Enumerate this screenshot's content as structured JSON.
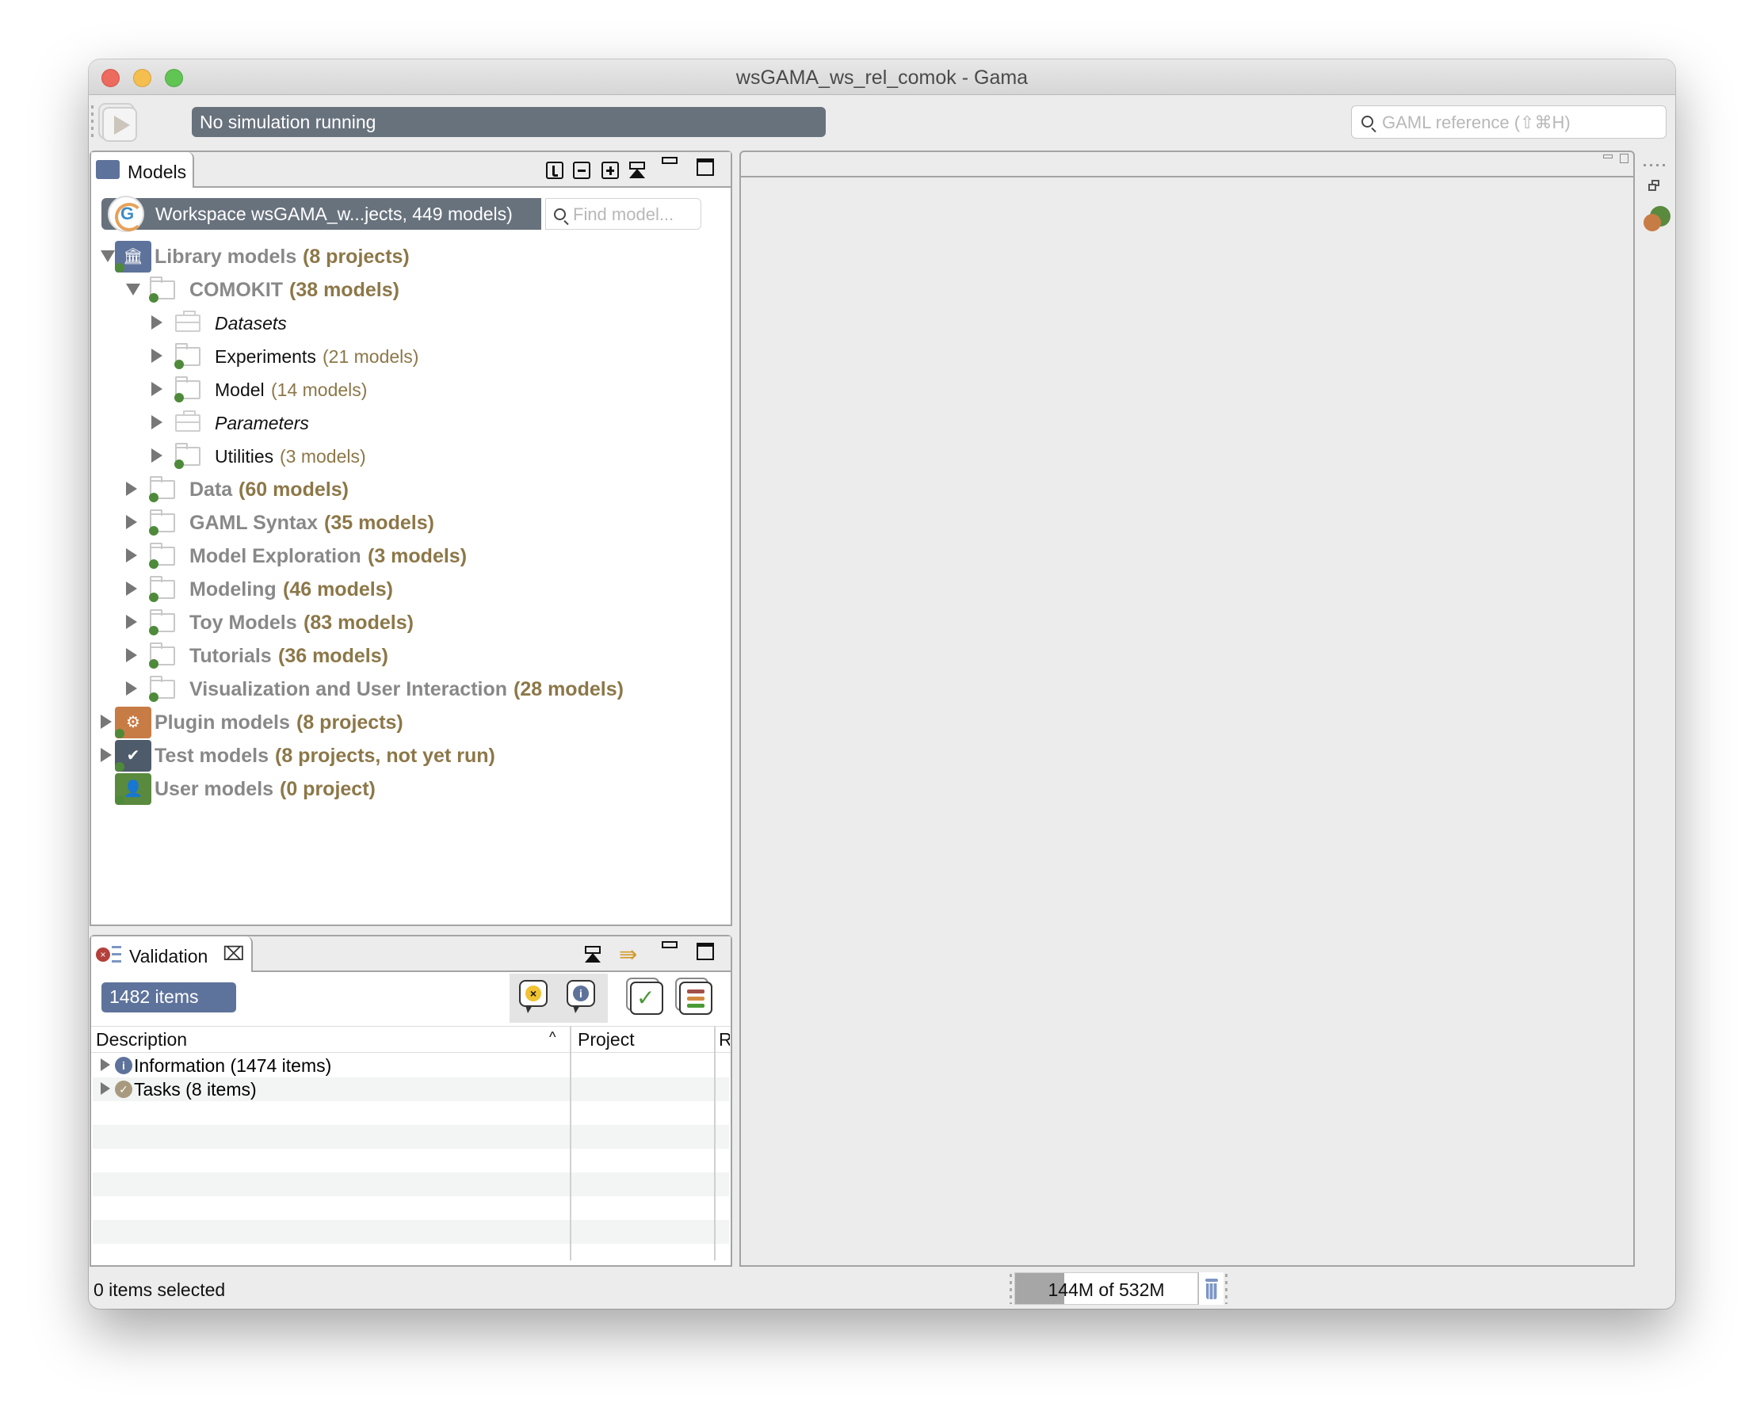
{
  "window": {
    "title": "wsGAMA_ws_rel_comok - Gama"
  },
  "toolbar": {
    "simulation_status": "No simulation running",
    "gaml_search_placeholder": "GAML reference (⇧⌘H)",
    "play_icon": "play-icon"
  },
  "models_panel": {
    "tab_label": "Models",
    "tab_icon": "folder-icon",
    "toolbar_icons": [
      "clock-icon",
      "collapse-all-icon",
      "expand-all-icon",
      "hourglass-icon",
      "minimize-icon",
      "maximize-icon"
    ],
    "workspace_label": "Workspace wsGAMA_w...jects, 449 models)",
    "find_placeholder": "Find model...",
    "tree": [
      {
        "level": 0,
        "expanded": true,
        "icon": "library-icon",
        "label": "Library models",
        "count": "(8 projects)",
        "style": "project"
      },
      {
        "level": 1,
        "expanded": true,
        "icon": "folder-icon",
        "label": "COMOKIT",
        "count": "(38 models)",
        "style": "category"
      },
      {
        "level": 2,
        "expanded": false,
        "icon": "box-icon",
        "label": "Datasets",
        "count": "",
        "style": "italic"
      },
      {
        "level": 2,
        "expanded": false,
        "icon": "folder-icon",
        "label": "Experiments",
        "count": "(21 models)",
        "style": "plain"
      },
      {
        "level": 2,
        "expanded": false,
        "icon": "folder-icon",
        "label": "Model",
        "count": "(14 models)",
        "style": "plain"
      },
      {
        "level": 2,
        "expanded": false,
        "icon": "box-icon",
        "label": "Parameters",
        "count": "",
        "style": "italic"
      },
      {
        "level": 2,
        "expanded": false,
        "icon": "folder-icon",
        "label": "Utilities",
        "count": "(3 models)",
        "style": "plain"
      },
      {
        "level": 1,
        "expanded": false,
        "icon": "folder-icon",
        "label": "Data",
        "count": "(60 models)",
        "style": "category"
      },
      {
        "level": 1,
        "expanded": false,
        "icon": "folder-icon",
        "label": "GAML Syntax",
        "count": "(35 models)",
        "style": "category"
      },
      {
        "level": 1,
        "expanded": false,
        "icon": "folder-icon",
        "label": "Model Exploration",
        "count": "(3 models)",
        "style": "category"
      },
      {
        "level": 1,
        "expanded": false,
        "icon": "folder-icon",
        "label": "Modeling",
        "count": "(46 models)",
        "style": "category"
      },
      {
        "level": 1,
        "expanded": false,
        "icon": "folder-icon",
        "label": "Toy Models",
        "count": "(83 models)",
        "style": "category"
      },
      {
        "level": 1,
        "expanded": false,
        "icon": "folder-icon",
        "label": "Tutorials",
        "count": "(36 models)",
        "style": "category"
      },
      {
        "level": 1,
        "expanded": false,
        "icon": "folder-icon",
        "label": "Visualization and User Interaction",
        "count": "(28 models)",
        "style": "category"
      },
      {
        "level": 0,
        "expanded": false,
        "icon": "plugin-gear-icon",
        "label": "Plugin models",
        "count": "(8 projects)",
        "style": "project"
      },
      {
        "level": 0,
        "expanded": false,
        "icon": "test-check-icon",
        "label": "Test models",
        "count": "(8 projects, not yet run)",
        "style": "project"
      },
      {
        "level": 0,
        "expanded": null,
        "icon": "user-icon",
        "label": "User models",
        "count": "(0 project)",
        "style": "project"
      }
    ]
  },
  "validation_panel": {
    "tab_label": "Validation",
    "tab_icon": "validation-icon",
    "close_icon": "close-icon",
    "items_count": "1482 items",
    "columns": [
      "Description",
      "Project",
      "R"
    ],
    "rows": [
      {
        "icon": "info-icon",
        "label": "Information (1474 items)"
      },
      {
        "icon": "task-icon",
        "label": "Tasks (8 items)"
      }
    ]
  },
  "status_bar": {
    "selection": "0 items selected",
    "memory": "144M of 532M",
    "memory_used_fraction": 0.27
  },
  "colors": {
    "status_bar_bg": "#68727d",
    "badge_bg": "#5e739b",
    "count_color": "#8c7748",
    "category_color": "#888888"
  }
}
